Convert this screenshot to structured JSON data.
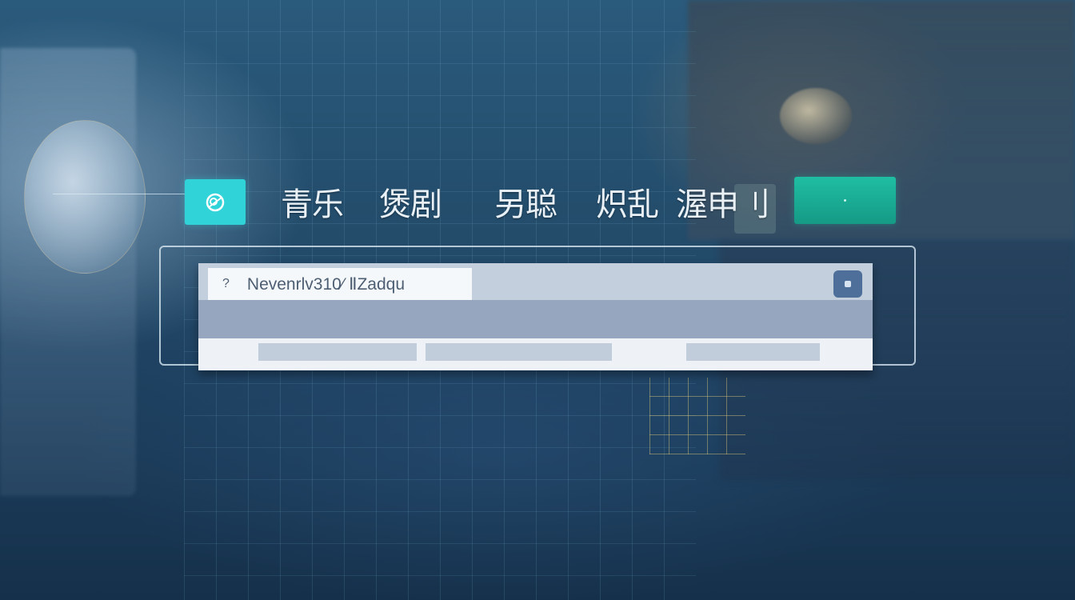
{
  "nav": {
    "items": [
      {
        "label": "青乐"
      },
      {
        "label": "煲剧"
      },
      {
        "label": "另聪"
      },
      {
        "label": "炽乱"
      },
      {
        "label": "渥申刂"
      }
    ]
  },
  "search": {
    "prefix": "?",
    "value": "Nevenrlv310⁄ ⅡZadqu"
  },
  "colors": {
    "accent_cyan": "#2fd3d8",
    "accent_teal": "#1fbea2",
    "search_button": "#4e6f9a"
  },
  "icons": {
    "logo": "circle-logo-icon",
    "search": "search-icon",
    "cta": "dot-icon"
  }
}
